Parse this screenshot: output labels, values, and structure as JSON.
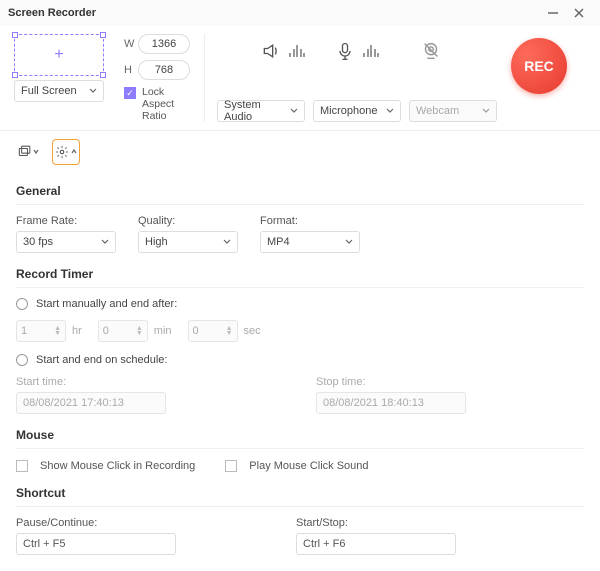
{
  "window": {
    "title": "Screen Recorder"
  },
  "capture": {
    "preset": "Full Screen",
    "width": "1366",
    "height": "768",
    "lock_label": "Lock Aspect Ratio"
  },
  "sources": {
    "audio": "System Audio",
    "mic": "Microphone",
    "cam": "Webcam"
  },
  "rec_label": "REC",
  "general": {
    "header": "General",
    "frame_label": "Frame Rate:",
    "frame_value": "30 fps",
    "quality_label": "Quality:",
    "quality_value": "High",
    "format_label": "Format:",
    "format_value": "MP4"
  },
  "timer": {
    "header": "Record Timer",
    "opt1": "Start manually and end after:",
    "hr": "1",
    "hr_u": "hr",
    "min": "0",
    "min_u": "min",
    "sec": "0",
    "sec_u": "sec",
    "opt2": "Start and end on schedule:",
    "start_label": "Start time:",
    "start_value": "08/08/2021 17:40:13",
    "stop_label": "Stop time:",
    "stop_value": "08/08/2021 18:40:13"
  },
  "mouse": {
    "header": "Mouse",
    "show": "Show Mouse Click in Recording",
    "sound": "Play Mouse Click Sound"
  },
  "shortcut": {
    "header": "Shortcut",
    "pause_label": "Pause/Continue:",
    "pause_value": "Ctrl + F5",
    "start_label": "Start/Stop:",
    "start_value": "Ctrl + F6"
  }
}
